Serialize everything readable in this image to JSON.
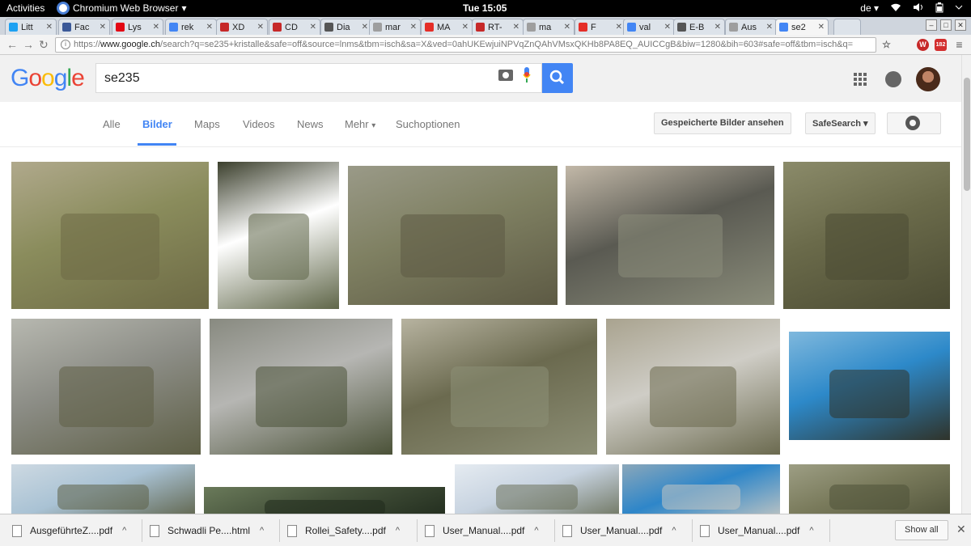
{
  "os": {
    "activities": "Activities",
    "app_name": "Chromium Web Browser",
    "app_caret": "▾",
    "clock": "Tue 15:05",
    "keyboard_layout": "de",
    "layout_caret": "▾"
  },
  "tabs": [
    {
      "label": "Litt",
      "icon": "twitter-icon",
      "color": "#1da1f2"
    },
    {
      "label": "Fac",
      "icon": "facebook-icon",
      "color": "#3b5998"
    },
    {
      "label": "Lys",
      "icon": "swiss-flag-icon",
      "color": "#e30613"
    },
    {
      "label": "rek",
      "icon": "google-icon",
      "color": "#4285f4"
    },
    {
      "label": "XD",
      "icon": "red-logo-icon",
      "color": "#c62828"
    },
    {
      "label": "CD",
      "icon": "red-logo-icon",
      "color": "#c62828"
    },
    {
      "label": "Dia",
      "icon": "gear-logo-icon",
      "color": "#555555"
    },
    {
      "label": "mar",
      "icon": "document-icon",
      "color": "#9e9e9e"
    },
    {
      "label": "MA",
      "icon": "youtube-icon",
      "color": "#e52d27"
    },
    {
      "label": "RT-",
      "icon": "red-z-icon",
      "color": "#c62828"
    },
    {
      "label": "ma",
      "icon": "document-icon",
      "color": "#9e9e9e"
    },
    {
      "label": "F",
      "icon": "youtube-icon",
      "color": "#e52d27"
    },
    {
      "label": "val",
      "icon": "google-icon",
      "color": "#4285f4"
    },
    {
      "label": "E-B",
      "icon": "gear-logo-icon",
      "color": "#555555"
    },
    {
      "label": "Aus",
      "icon": "document-icon",
      "color": "#9e9e9e"
    },
    {
      "label": "se2",
      "icon": "google-icon",
      "color": "#4285f4"
    }
  ],
  "omnibox": {
    "prefix": "https://",
    "host": "www.google.ch",
    "path": "/search?q=se235+kristalle&safe=off&source=lnms&tbm=isch&sa=X&ved=0ahUKEwjuiNPVqZnQAhVMsxQKHb8PA8EQ_AUICCgB&biw=1280&bih=603#safe=off&tbm=isch&q="
  },
  "extensions": {
    "abp_count": "182"
  },
  "google": {
    "logo_letters": [
      "G",
      "o",
      "o",
      "g",
      "l",
      "e"
    ],
    "logo_colors": [
      "#4285f4",
      "#ea4335",
      "#fbbc05",
      "#4285f4",
      "#34a853",
      "#ea4335"
    ],
    "query": "se235"
  },
  "search_tabs": [
    "Alle",
    "Bilder",
    "Maps",
    "Videos",
    "News",
    "Mehr",
    "Suchoptionen"
  ],
  "search_tabs_more_caret": "▾",
  "active_tab": "Bilder",
  "buttons": {
    "saved_images": "Gespeicherte Bilder ansehen",
    "safesearch": "SafeSearch",
    "safesearch_caret": "▾"
  },
  "image_results": [
    {
      "name": "soldiers-sitting-radios",
      "colors": [
        "#8a8c5c",
        "#6d6a45",
        "#b0a98c"
      ]
    },
    {
      "name": "radio-backpack-product",
      "colors": [
        "#ffffff",
        "#5f6648",
        "#3b3f2c"
      ]
    },
    {
      "name": "soldiers-bench-radio",
      "colors": [
        "#7f8062",
        "#5d5a44",
        "#9a9a88"
      ]
    },
    {
      "name": "radio-classroom",
      "colors": [
        "#5a5a52",
        "#8a8c7a",
        "#c2b8a8"
      ]
    },
    {
      "name": "camouflage-net-radio",
      "colors": [
        "#6a6a4a",
        "#4b4b33",
        "#8b8b6a"
      ]
    },
    {
      "name": "three-soldiers-standing",
      "colors": [
        "#8c8d86",
        "#5e5f46",
        "#b7b8b0"
      ]
    },
    {
      "name": "se235-device-grey",
      "colors": [
        "#b6b6b3",
        "#4b5238",
        "#888a80"
      ]
    },
    {
      "name": "soldiers-kneeling-radio",
      "colors": [
        "#6b6a4f",
        "#8d8f76",
        "#b7b3a0"
      ]
    },
    {
      "name": "soldiers-classroom-desks",
      "colors": [
        "#cfcdc6",
        "#6b6a4f",
        "#a9a38f"
      ]
    },
    {
      "name": "se235-device-blue-sky",
      "colors": [
        "#2d89c9",
        "#2f332a",
        "#7fb8dd"
      ]
    },
    {
      "name": "vehicles-antennas",
      "colors": [
        "#a9c2d4",
        "#5d6147",
        "#cdd9e2"
      ]
    },
    {
      "name": "radio-keypad-closeup",
      "colors": [
        "#44513a",
        "#1f2a1c",
        "#6a7a5a"
      ]
    },
    {
      "name": "vehicle-antenna-mountains",
      "colors": [
        "#c7d3e0",
        "#6b715b",
        "#e5ebf1"
      ]
    },
    {
      "name": "building-antennas",
      "colors": [
        "#2e86c9",
        "#c4c6c2",
        "#8aa7ba"
      ]
    },
    {
      "name": "soldiers-group-trees",
      "colors": [
        "#7a7b5c",
        "#4f5239",
        "#9d9e84"
      ]
    }
  ],
  "downloads": [
    {
      "filename": "AusgeführteZ....pdf"
    },
    {
      "filename": "Schwadli Pe....html"
    },
    {
      "filename": "Rollei_Safety....pdf"
    },
    {
      "filename": "User_Manual....pdf"
    },
    {
      "filename": "User_Manual....pdf"
    },
    {
      "filename": "User_Manual....pdf"
    }
  ],
  "downloads_bar": {
    "show_all": "Show all",
    "close": "✕",
    "caret": "^"
  }
}
